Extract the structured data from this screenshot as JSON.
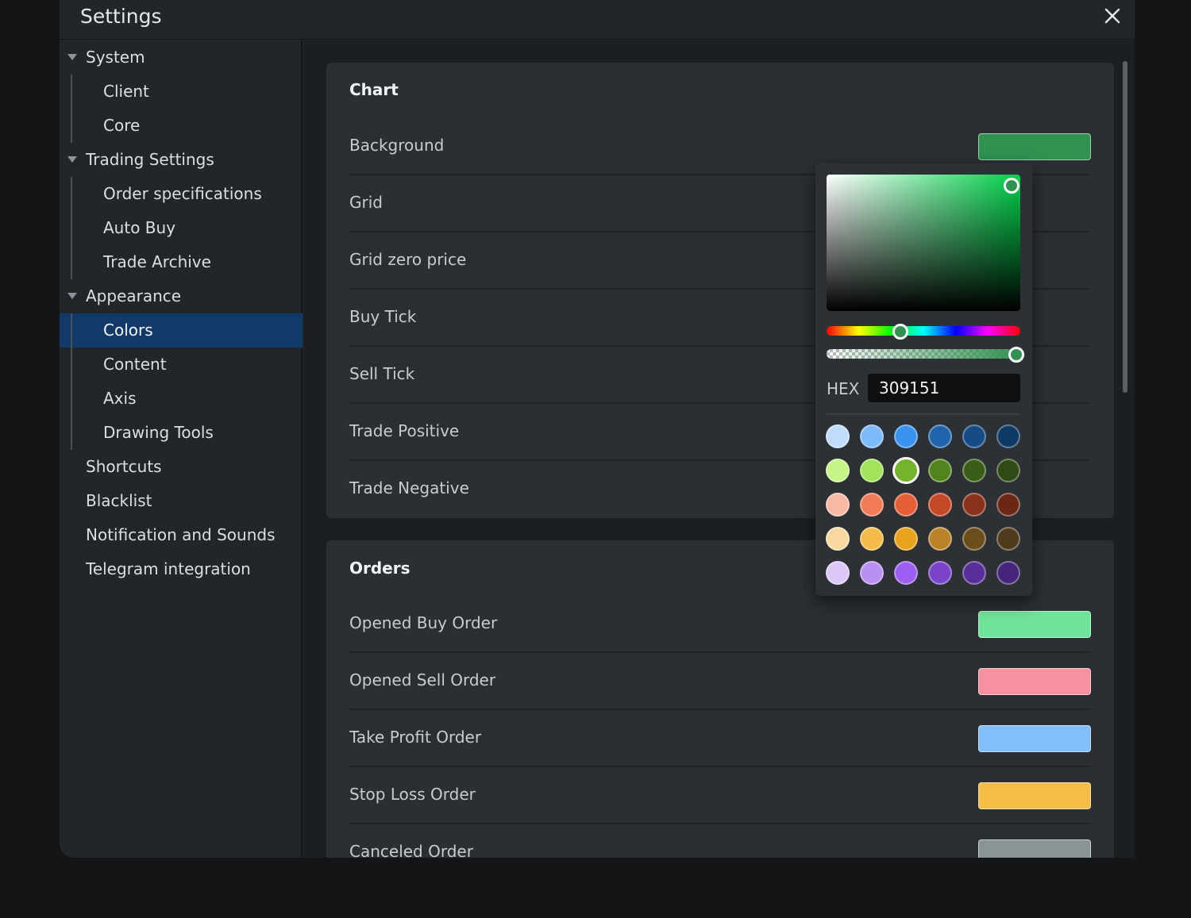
{
  "window": {
    "title": "Settings",
    "close_icon": "close-icon"
  },
  "sidebar": {
    "items": [
      {
        "label": "System",
        "kind": "group",
        "expanded": true
      },
      {
        "label": "Client",
        "kind": "child"
      },
      {
        "label": "Core",
        "kind": "child"
      },
      {
        "label": "Trading Settings",
        "kind": "group",
        "expanded": true
      },
      {
        "label": "Order specifications",
        "kind": "child"
      },
      {
        "label": "Auto Buy",
        "kind": "child"
      },
      {
        "label": "Trade Archive",
        "kind": "child"
      },
      {
        "label": "Appearance",
        "kind": "group",
        "expanded": true
      },
      {
        "label": "Colors",
        "kind": "child",
        "selected": true
      },
      {
        "label": "Content",
        "kind": "child"
      },
      {
        "label": "Axis",
        "kind": "child"
      },
      {
        "label": "Drawing Tools",
        "kind": "child"
      },
      {
        "label": "Shortcuts",
        "kind": "top"
      },
      {
        "label": "Blacklist",
        "kind": "top"
      },
      {
        "label": "Notification and Sounds",
        "kind": "top"
      },
      {
        "label": "Telegram integration",
        "kind": "top"
      }
    ]
  },
  "chart_section": {
    "title": "Chart",
    "rows": [
      {
        "label": "Background",
        "color": "#309151"
      },
      {
        "label": "Grid"
      },
      {
        "label": "Grid zero price"
      },
      {
        "label": "Buy Tick"
      },
      {
        "label": "Sell Tick"
      },
      {
        "label": "Trade Positive"
      },
      {
        "label": "Trade Negative"
      }
    ]
  },
  "orders_section": {
    "title": "Orders",
    "rows": [
      {
        "label": "Opened Buy Order",
        "color": "#72e39b"
      },
      {
        "label": "Opened Sell Order",
        "color": "#f7909f"
      },
      {
        "label": "Take Profit Order",
        "color": "#82bffa"
      },
      {
        "label": "Stop Loss Order",
        "color": "#f6bd48"
      },
      {
        "label": "Canceled Order",
        "color": "#8a9497"
      }
    ]
  },
  "color_picker": {
    "hex_label": "HEX",
    "hex_value": "309151",
    "current_color": "#309151",
    "hue_color": "#00d14a",
    "presets": [
      [
        "#bfdcff",
        "#7fbafa",
        "#3b93ef",
        "#2064ad",
        "#164b85",
        "#103a66"
      ],
      [
        "#c5f587",
        "#a2e35b",
        "#73b42a",
        "#52841e",
        "#3a5e17",
        "#2f4a14"
      ],
      [
        "#f8b8a4",
        "#f37c58",
        "#e45e37",
        "#c44726",
        "#8a3219",
        "#6a2714"
      ],
      [
        "#fad9a0",
        "#f4bb4a",
        "#e9a21b",
        "#b98229",
        "#6c4c1b",
        "#4f3a1c"
      ],
      [
        "#dcc7fa",
        "#b98ff4",
        "#9d5ef1",
        "#7a43c9",
        "#5a2e9a",
        "#44257a"
      ]
    ],
    "selected_preset": {
      "row": 1,
      "col": 2
    }
  }
}
